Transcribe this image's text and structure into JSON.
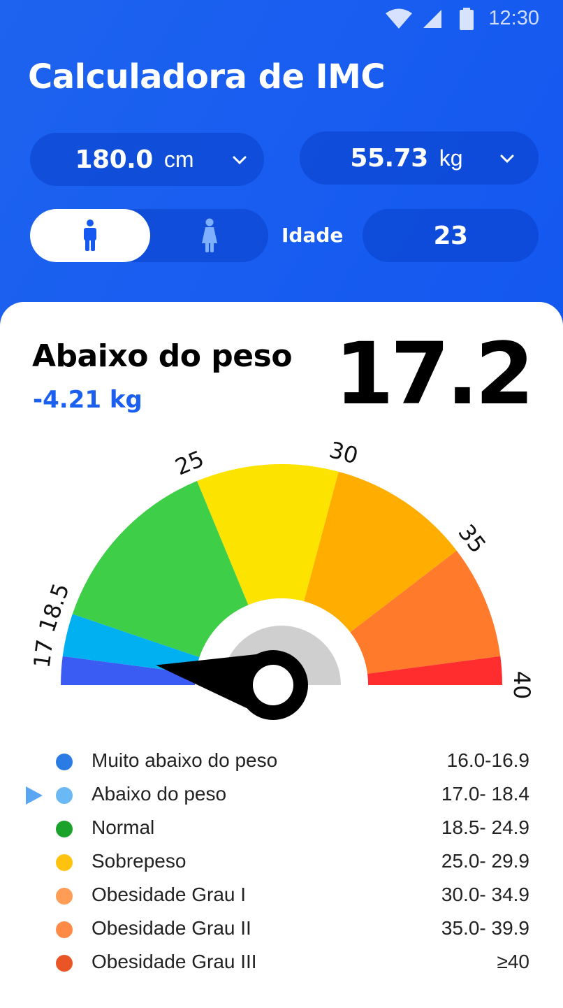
{
  "status_bar": {
    "time": "12:30",
    "icons": [
      "wifi-icon",
      "signal-icon",
      "battery-icon"
    ]
  },
  "app": {
    "title": "Calculadora de IMC"
  },
  "inputs": {
    "height": {
      "value": "180.0",
      "unit": "cm"
    },
    "weight": {
      "value": "55.73",
      "unit": "kg"
    },
    "gender": {
      "options": [
        "male",
        "female"
      ],
      "selected": "male"
    },
    "age": {
      "label": "Idade",
      "value": "23"
    }
  },
  "result": {
    "category": "Abaixo do peso",
    "difference": "-4.21 kg",
    "bmi": "17.2"
  },
  "gauge": {
    "min": 16,
    "max": 40,
    "value": 17.2,
    "tick_labels": [
      "17",
      "18.5",
      "25",
      "30",
      "35",
      "40"
    ],
    "segments": [
      {
        "from": 16,
        "to": 17,
        "color": "#3a5cf3"
      },
      {
        "from": 17,
        "to": 18.5,
        "color": "#00b0f0"
      },
      {
        "from": 18.5,
        "to": 25,
        "color": "#3fce47"
      },
      {
        "from": 25,
        "to": 30,
        "color": "#fde300"
      },
      {
        "from": 30,
        "to": 35,
        "color": "#ffae00"
      },
      {
        "from": 35,
        "to": 39,
        "color": "#ff7a2b"
      },
      {
        "from": 39,
        "to": 40,
        "color": "#ff2d2d"
      }
    ]
  },
  "legend": {
    "selected_index": 1,
    "items": [
      {
        "label": "Muito abaixo do peso",
        "range": "16.0-16.9",
        "color": "#2a7be4"
      },
      {
        "label": "Abaixo do peso",
        "range": "17.0- 18.4",
        "color": "#6ab9f5"
      },
      {
        "label": "Normal",
        "range": "18.5- 24.9",
        "color": "#1aa22a"
      },
      {
        "label": "Sobrepeso",
        "range": "25.0- 29.9",
        "color": "#ffc20e"
      },
      {
        "label": "Obesidade Grau I",
        "range": "30.0- 34.9",
        "color": "#ff9c55"
      },
      {
        "label": "Obesidade Grau II",
        "range": "35.0- 39.9",
        "color": "#ff8a45"
      },
      {
        "label": "Obesidade Grau III",
        "range": "≥40",
        "color": "#ea5526"
      }
    ]
  }
}
